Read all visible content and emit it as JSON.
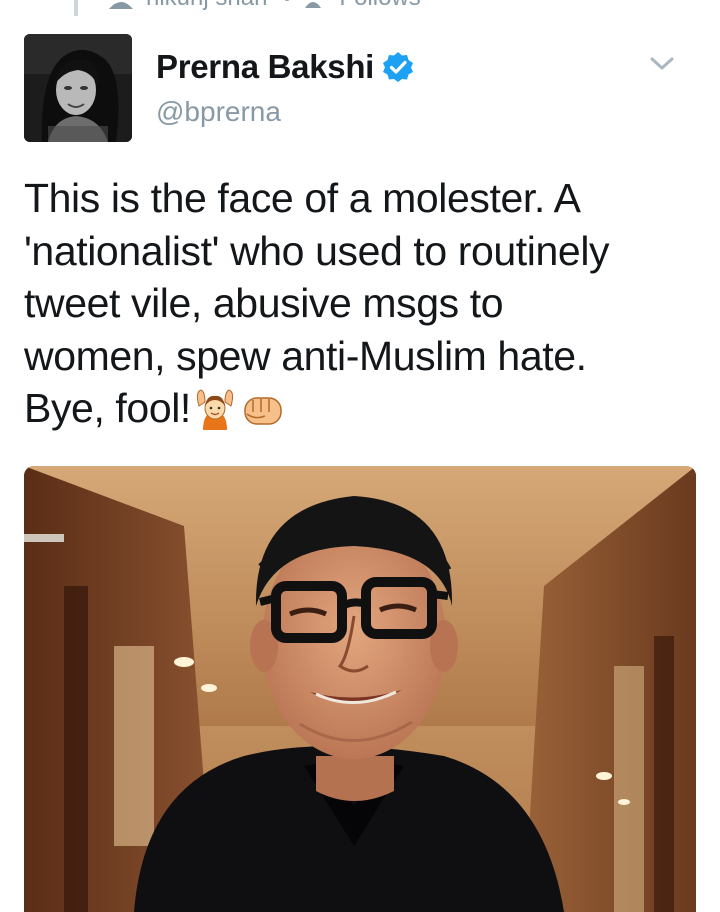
{
  "reply_context": {
    "text": "nikunj shah",
    "follows": "Follows"
  },
  "tweet": {
    "author": {
      "display_name": "Prerna Bakshi",
      "handle": "@bprerna",
      "verified": true,
      "verified_icon": "verified-badge-icon",
      "avatar": "profile-avatar"
    },
    "text_lines": [
      "This is the face of a molester. A",
      "'nationalist' who used to routinely",
      "tweet vile, abusive msgs to",
      "women, spew anti-Muslim hate.",
      "Bye, fool!"
    ],
    "emojis": [
      "person-gesturing-ok-emoji",
      "oncoming-fist-emoji"
    ],
    "media": "attached-photo-man-with-glasses"
  },
  "colors": {
    "verified": "#1da1f2",
    "secondary_text": "#8899a6",
    "primary_text": "#14171a"
  }
}
